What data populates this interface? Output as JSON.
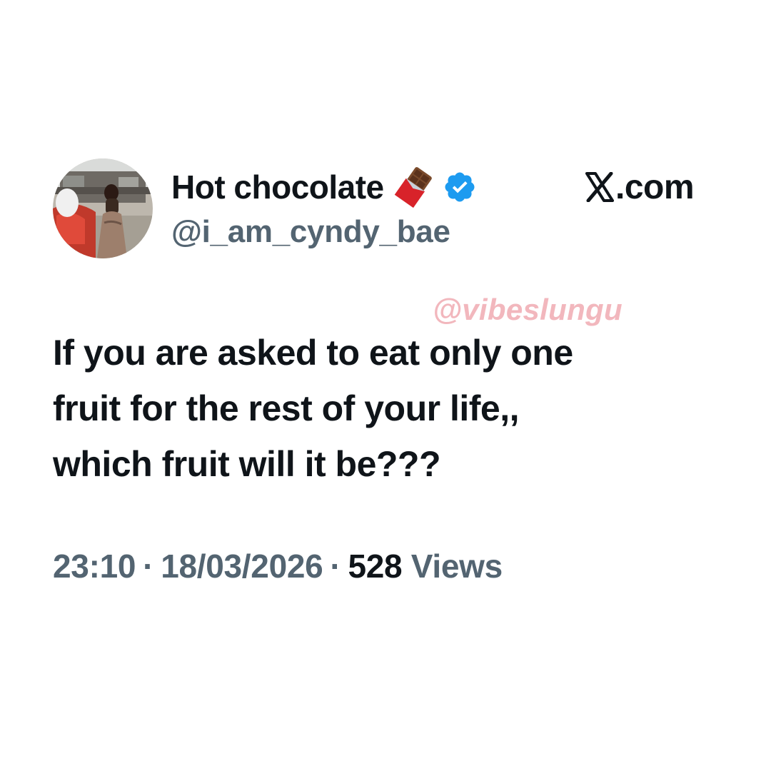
{
  "author": {
    "display_name": "Hot chocolate",
    "name_emoji_icon": "chocolate-bar-icon",
    "verified_icon": "verified-badge-icon",
    "handle": "@i_am_cyndy_bae",
    "avatar": "profile-photo"
  },
  "brand": {
    "logo_icon": "x-logo-icon",
    "domain": ".com"
  },
  "watermark": "@vibeslungu",
  "tweet": {
    "lines": [
      "If you are asked to eat only one",
      "fruit for the rest of your life,,",
      "which fruit will it be???"
    ]
  },
  "meta": {
    "time": "23:10",
    "separator": "·",
    "date": "18/03/2026",
    "views_count": "528",
    "views_label": "Views"
  },
  "colors": {
    "text_primary": "#0f1419",
    "text_secondary": "#536471",
    "verified_blue": "#1d9bf0",
    "watermark_pink": "#f2b7bd",
    "background": "#ffffff"
  }
}
